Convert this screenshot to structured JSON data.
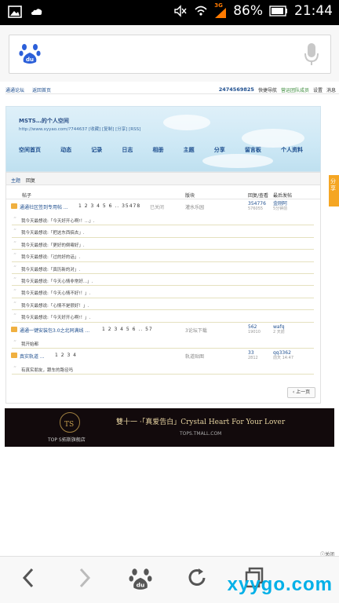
{
  "status": {
    "battery_pct": "86%",
    "time": "21:44",
    "net": "3G"
  },
  "forum_header": {
    "site_links": [
      "通通论坛",
      "返回首页"
    ],
    "user_id": "2474569825",
    "quick_nav": "快捷导航",
    "verify": "营运团队成员",
    "settings": "设置",
    "messages": "消息"
  },
  "space": {
    "title": "MSTS…的个人空间",
    "url": "http://www.xyyao.com/?744637 [收藏] [复制] [分享] [RSS]",
    "nav": [
      "空间首页",
      "动态",
      "记录",
      "日志",
      "相册",
      "主题",
      "分享",
      "留言板",
      "个人资料"
    ]
  },
  "list": {
    "tabs": [
      "主题",
      "回复"
    ],
    "head": {
      "thread": "帖子",
      "forum": "版块",
      "stat": "回复/查看",
      "last": "最后发帖"
    },
    "threads": [
      {
        "title": "通通社区签到专用帖 ...",
        "pages": "1 2 3 4 5 6 .. 35478",
        "status": "已关闭",
        "forum": "灌水乐园",
        "replies": "354776",
        "views": "576055",
        "last_user": "金刚阿",
        "last_time": "5分钟前",
        "quotes": [
          "我今天最想说:「今天好开心啊!！...」.",
          "我今天最想说:「把这东西搞去」.",
          "我今天最想说:「更好的倒霉好」.",
          "我今天最想说:「过的好的话」.",
          "我今天最想说:「真历新的对」.",
          "我今天最想说:「今天心情非常好...」.",
          "我今天最想说:「今天心情不好!！」.",
          "我今天最想说:「心情不是很好！」.",
          "我今天最想说:「今天好开心啊!！」."
        ]
      },
      {
        "title": "通通一键安装包3.0之北同满线 ...",
        "pages": "1 2 3 4 5 6 .. 57",
        "status": "",
        "forum": "3论坛下载",
        "replies": "562",
        "views": "19010",
        "last_user": "wafq",
        "last_time": "2 天前",
        "quotes": [
          "我开始都"
        ]
      },
      {
        "title": "真实轨道 ...",
        "pages": "1 2 3 4",
        "status": "",
        "forum": "轨道贴图",
        "replies": "33",
        "views": "2812",
        "last_user": "qq3362",
        "last_time": "前天 14:47",
        "quotes": [
          "有真实朋友，跟车的路径吗"
        ]
      }
    ],
    "prev_page": "上一页"
  },
  "share_label": "分享",
  "ad": {
    "brand": "TOP S",
    "shop": "TOP S拓斯旗舰店",
    "slogan": "雙十一 ·「真爱告白」Crystal Heart For Your Lover",
    "url": "TOPS.TMALL.COM",
    "close": "关闭"
  },
  "watermark": "xyygo.com",
  "colors": {
    "link": "#1f4f8f",
    "accent": "#f5a623",
    "statusbar": "#000000"
  }
}
